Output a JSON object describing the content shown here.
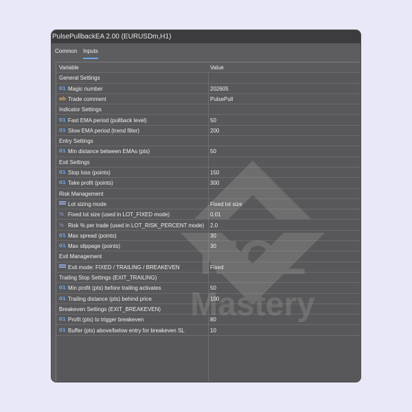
{
  "window": {
    "title": "PulsePullbackEA 2.00 (EURUSDm,H1)"
  },
  "tabs": [
    {
      "label": "Common"
    },
    {
      "label": "Inputs"
    }
  ],
  "columns": {
    "variable": "Variable",
    "value": "Value"
  },
  "rows": [
    {
      "kind": "section",
      "label": "General Settings"
    },
    {
      "kind": "param",
      "icon": "int",
      "label": "Magic number",
      "value": "202605"
    },
    {
      "kind": "param",
      "icon": "str",
      "label": "Trade comment",
      "value": "PulsePull"
    },
    {
      "kind": "section",
      "label": "Indicator Settings"
    },
    {
      "kind": "param",
      "icon": "int",
      "label": "Fast EMA period (pullback level)",
      "value": "50"
    },
    {
      "kind": "param",
      "icon": "int",
      "label": "Slow EMA period (trend filter)",
      "value": "200"
    },
    {
      "kind": "section",
      "label": "Entry Settings"
    },
    {
      "kind": "param",
      "icon": "int",
      "label": "Min distance between EMAs (pts)",
      "value": "50"
    },
    {
      "kind": "section",
      "label": "Exit Settings"
    },
    {
      "kind": "param",
      "icon": "int",
      "label": "Stop loss (points)",
      "value": "150"
    },
    {
      "kind": "param",
      "icon": "int",
      "label": "Take profit (points)",
      "value": "300"
    },
    {
      "kind": "section",
      "label": "Risk Management"
    },
    {
      "kind": "param",
      "icon": "enum",
      "label": "Lot sizing mode",
      "value": "Fixed lot size"
    },
    {
      "kind": "param",
      "icon": "dbl",
      "label": "Fixed lot size (used in LOT_FIXED mode)",
      "value": "0.01"
    },
    {
      "kind": "param",
      "icon": "dbl",
      "label": "Risk % per trade (used in LOT_RISK_PERCENT mode)",
      "value": "2.0"
    },
    {
      "kind": "param",
      "icon": "int",
      "label": "Max spread (points)",
      "value": "30"
    },
    {
      "kind": "param",
      "icon": "int",
      "label": "Max slippage (points)",
      "value": "30"
    },
    {
      "kind": "section",
      "label": "Exit Management"
    },
    {
      "kind": "param",
      "icon": "enum",
      "label": "Exit mode: FIXED / TRAILING / BREAKEVEN",
      "value": "Fixed"
    },
    {
      "kind": "section",
      "label": "Trailing Stop Settings (EXIT_TRAILING)"
    },
    {
      "kind": "param",
      "icon": "int",
      "label": "Min profit (pts) before trailing activates",
      "value": "50"
    },
    {
      "kind": "param",
      "icon": "int",
      "label": "Trailing distance (pts) behind price",
      "value": "100"
    },
    {
      "kind": "section",
      "label": "Breakeven Settings (EXIT_BREAKEVEN)"
    },
    {
      "kind": "param",
      "icon": "int",
      "label": "Profit (pts) to trigger breakeven",
      "value": "80"
    },
    {
      "kind": "param",
      "icon": "int",
      "label": "Buffer (pts) above/below entry for breakeven SL",
      "value": "10"
    }
  ],
  "icon_glyphs": {
    "int": "01",
    "str": "ab",
    "dbl": "½"
  },
  "watermark": {
    "text_top": "MQL",
    "text_bottom": "Mastery"
  },
  "colors": {
    "background": "#e9e8f6",
    "window": "#5d5d5f",
    "accent": "#6ea7e8"
  }
}
